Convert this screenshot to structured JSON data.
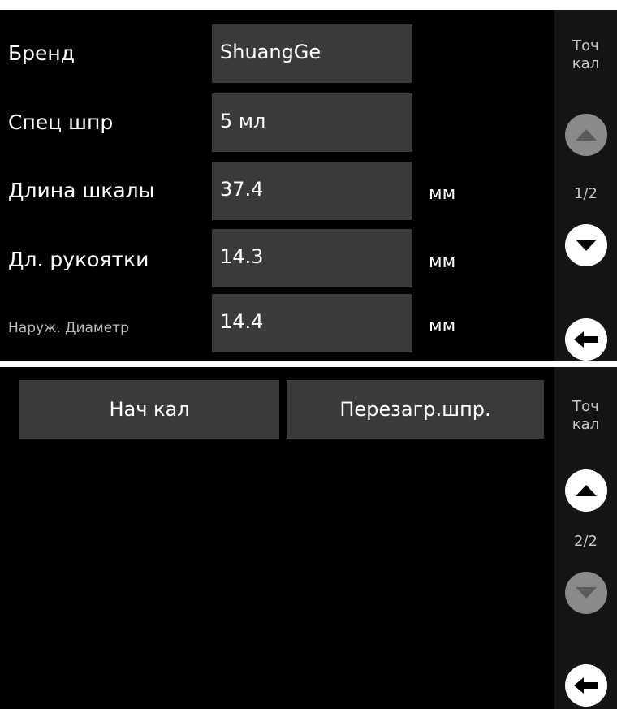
{
  "screen1": {
    "fields": [
      {
        "label": "Бренд",
        "value": "ShuangGe",
        "unit": ""
      },
      {
        "label": "Спец шпр",
        "value": "5 мл",
        "unit": ""
      },
      {
        "label": "Длина шкалы",
        "value": "37.4",
        "unit": "мм"
      },
      {
        "label": "Дл. рукоятки",
        "value": "14.3",
        "unit": "мм"
      },
      {
        "label": "Наруж. Диаметр",
        "value": "14.4",
        "unit": "мм"
      }
    ],
    "sidebar": {
      "title_line1": "Точ",
      "title_line2": "кал",
      "page": "1/2"
    }
  },
  "screen2": {
    "buttons": {
      "start_cal": "Нач кал",
      "reload_syringe": "Перезагр.шпр."
    },
    "sidebar": {
      "title_line1": "Точ",
      "title_line2": "кал",
      "page": "2/2"
    }
  },
  "colors": {
    "background": "#000000",
    "field": "#3a3a3a",
    "sidebar": "#141414",
    "text": "#ffffff",
    "disabled_button": "#8a8a8a"
  },
  "icons": [
    "up-arrow-icon",
    "down-arrow-icon",
    "back-arrow-icon"
  ]
}
